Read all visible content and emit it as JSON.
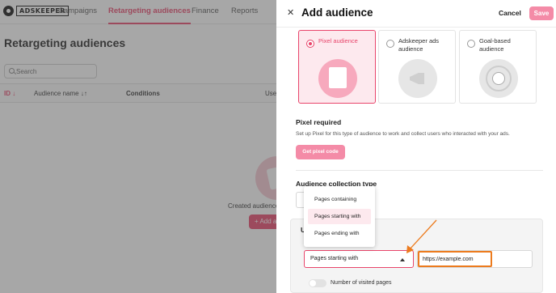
{
  "brand": {
    "logo_text": "ADSKEEPER",
    "accent": "#e8456b",
    "callout": "#ec7b1e"
  },
  "nav": {
    "items": [
      {
        "label": "Campaigns"
      },
      {
        "label": "Retargeting audiences"
      },
      {
        "label": "Finance"
      },
      {
        "label": "Reports"
      }
    ],
    "active": "Retargeting audiences"
  },
  "page": {
    "title": "Retargeting audiences",
    "search_placeholder": "Search",
    "columns": [
      "ID",
      "Audience name",
      "Conditions",
      "Use"
    ],
    "empty_text": "Created audiences",
    "empty_button": "+ Add a"
  },
  "drawer": {
    "title": "Add audience",
    "close_icon": "close-icon",
    "cancel": "Cancel",
    "save": "Save",
    "types": [
      {
        "label": "Pixel audience",
        "selected": true,
        "icon": "pixel-user-icon"
      },
      {
        "label": "Adskeeper ads audience",
        "selected": false,
        "icon": "megaphone-icon"
      },
      {
        "label": "Goal-based audience",
        "selected": false,
        "icon": "target-icon"
      }
    ],
    "pixel": {
      "title": "Pixel required",
      "desc": "Set up Pixel for this type of audience to work and collect users who interacted with your ads.",
      "button": "Get pixel code"
    },
    "collection": {
      "title": "Audience collection type",
      "rules_title": "U",
      "select_value": "Pages starting with",
      "options": [
        "Pages containing",
        "Pages starting with",
        "Pages ending with"
      ],
      "highlighted_option": "Pages starting with",
      "url_value": "https://example.com",
      "toggle_label": "Number of visited pages",
      "toggle_on": false
    }
  }
}
